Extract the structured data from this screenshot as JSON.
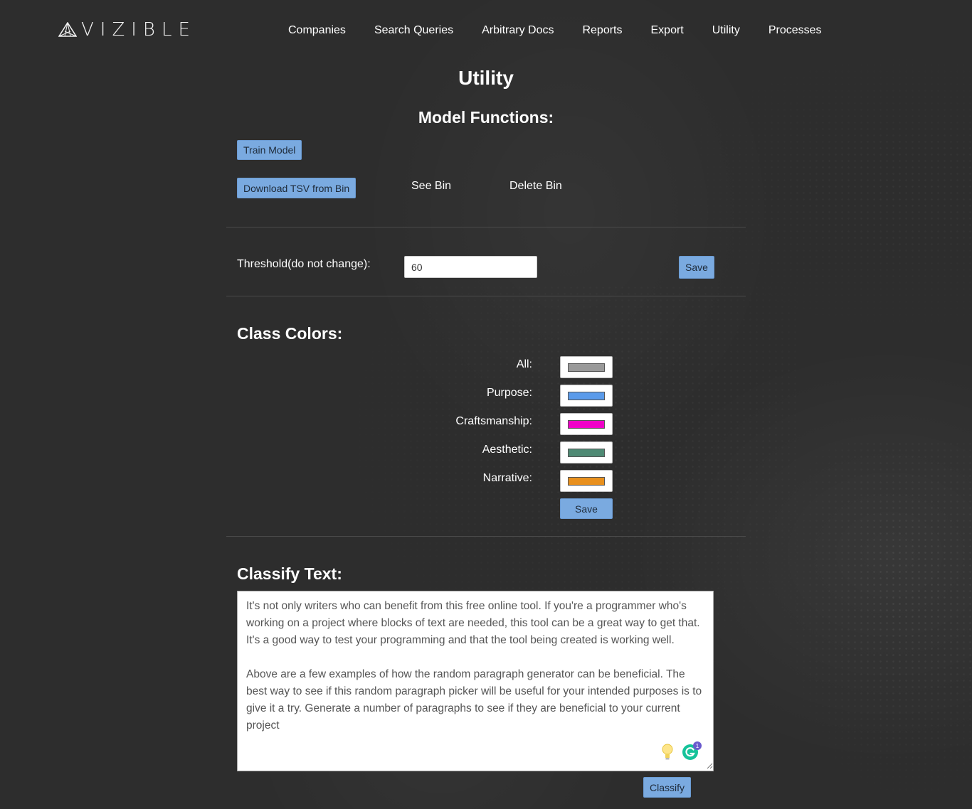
{
  "brand": {
    "logo_text": "VIZIBLE"
  },
  "nav": {
    "items": [
      {
        "label": "Companies"
      },
      {
        "label": "Search Queries"
      },
      {
        "label": "Arbitrary Docs"
      },
      {
        "label": "Reports"
      },
      {
        "label": "Export"
      },
      {
        "label": "Utility"
      },
      {
        "label": "Processes"
      }
    ]
  },
  "page": {
    "title": "Utility"
  },
  "model_functions": {
    "title": "Model Functions:",
    "train_label": "Train Model",
    "download_label": "Download TSV from Bin",
    "see_bin_label": "See Bin",
    "delete_bin_label": "Delete Bin"
  },
  "threshold": {
    "label": "Threshold(do not change):",
    "value": "60",
    "save_label": "Save"
  },
  "class_colors": {
    "title": "Class Colors:",
    "items": [
      {
        "label": "All:",
        "color": "#999999"
      },
      {
        "label": "Purpose:",
        "color": "#5b9bea"
      },
      {
        "label": "Craftsmanship:",
        "color": "#f000c8"
      },
      {
        "label": "Aesthetic:",
        "color": "#4f8a74"
      },
      {
        "label": "Narrative:",
        "color": "#e8901e"
      }
    ],
    "save_label": "Save"
  },
  "classify": {
    "title": "Classify Text:",
    "text": "It's not only writers who can benefit from this free online tool. If you're a programmer who's working on a project where blocks of text are needed, this tool can be a great way to get that. It's a good way to test your programming and that the tool being created is working well.\n\nAbove are a few examples of how the random paragraph generator can be beneficial. The best way to see if this random paragraph picker will be useful for your intended purposes is to give it a try. Generate a number of paragraphs to see if they are beneficial to your current project",
    "button_label": "Classify",
    "grammarly_badge": "1"
  }
}
